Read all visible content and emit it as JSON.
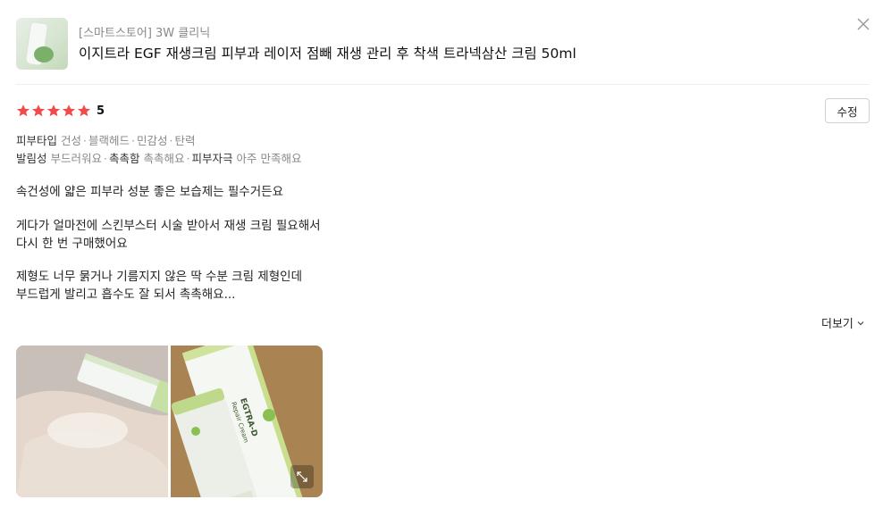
{
  "product": {
    "store": "[스마트스토어] 3W 클리닉",
    "title": "이지트라 EGF 재생크림 피부과 레이저 점빼 재생 관리 후 착색 트라넥삼산 크림 50ml"
  },
  "icons": {
    "close": "close-icon",
    "star": "star-icon",
    "chevron": "chevron-down-icon",
    "expand": "expand-icon"
  },
  "colors": {
    "star": "#f04a4a",
    "muted": "#888888"
  },
  "review": {
    "rating": 5,
    "score_label": "5",
    "edit_label": "수정",
    "attributes": {
      "line1": {
        "key": "피부타입",
        "values": [
          "건성",
          "블랙헤드",
          "민감성",
          "탄력"
        ]
      },
      "line2": [
        {
          "key": "발림성",
          "value": "부드러워요"
        },
        {
          "key": "촉촉함",
          "value": "촉촉해요"
        },
        {
          "key": "피부자극",
          "value": "아주 만족해요"
        }
      ]
    },
    "body": [
      "속건성에 얇은 피부라 성분 좋은 보습제는 필수거든요",
      "게다가 얼마전에 스킨부스터 시술 받아서 재생 크림 필요해서",
      "다시 한 번 구매했어요",
      "제형도 너무 묽거나 기름지지 않은 딱 수분 크림 제형인데",
      "부드럽게 발리고 흡수도 잘 되서 촉촉해요..."
    ],
    "more_label": "더보기"
  },
  "photos": {
    "photo2_tube_front": "EGTRA-D",
    "photo2_tube_sub": "Repair Cream"
  }
}
